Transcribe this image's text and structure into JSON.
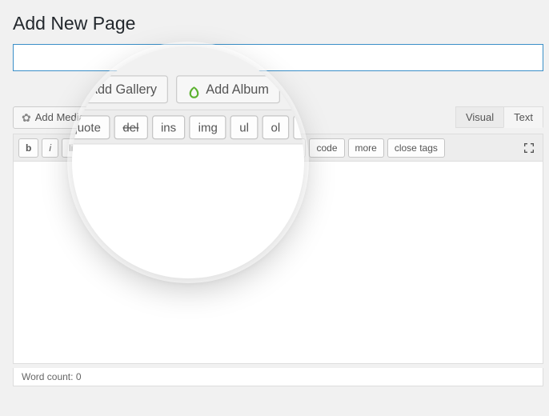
{
  "page": {
    "title": "Add New Page"
  },
  "title_field": {
    "value": "",
    "placeholder": ""
  },
  "media_buttons": {
    "add_media": {
      "label": "Add Media"
    },
    "add_gallery": {
      "label": "Add Gallery"
    },
    "add_album": {
      "label": "Add Album"
    }
  },
  "tabs": {
    "visual": "Visual",
    "text": "Text",
    "active": "text"
  },
  "quicktags": {
    "b": "b",
    "i": "i",
    "link": "link",
    "bquote": "b-quote",
    "del": "del",
    "ins": "ins",
    "img": "img",
    "ul": "ul",
    "ol": "ol",
    "li": "li",
    "code": "code",
    "more": "more",
    "close": "close tags"
  },
  "editor": {
    "content": ""
  },
  "status": {
    "word_count_label": "Word count:",
    "word_count": "0"
  }
}
